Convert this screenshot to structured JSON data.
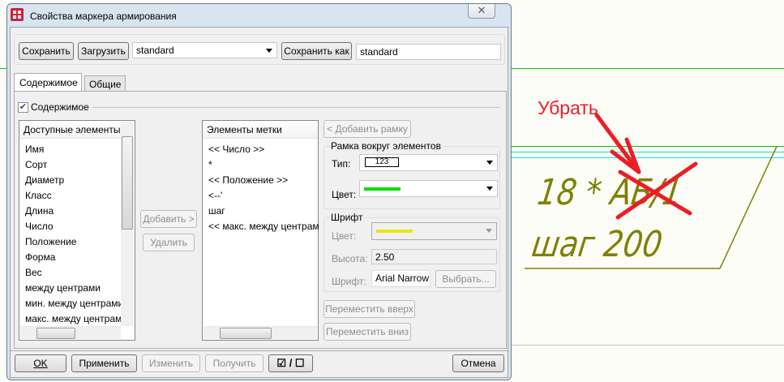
{
  "window": {
    "title": "Свойства маркера армирования",
    "close": "✕"
  },
  "toolbar": {
    "save": "Сохранить",
    "load": "Загрузить",
    "preset": "standard",
    "save_as": "Сохранить как",
    "save_as_name": "standard"
  },
  "tabs": [
    {
      "label": "Содержимое",
      "active": true
    },
    {
      "label": "Общие",
      "active": false
    }
  ],
  "content": {
    "checkbox_label": "Содержимое",
    "checked": true,
    "available": {
      "header": "Доступные элементы",
      "items": [
        "Имя",
        "Сорт",
        "Диаметр",
        "Класс",
        "Длина",
        "Число",
        "Положение",
        "Форма",
        "Вес",
        "между центрами",
        "мин. между центрами",
        "макс. между центрами"
      ]
    },
    "add": "Добавить >",
    "remove": "Удалить",
    "marker": {
      "header": "Элементы метки",
      "items": [
        "<< Число >>",
        "*",
        "<< Положение >>",
        "<--'",
        "шаг",
        "<< макс. между центрами >>"
      ]
    },
    "add_frame": "< Добавить рамку",
    "frame": {
      "title": "Рамка вокруг элементов",
      "type_label": "Тип:",
      "type_value": "123",
      "color_label": "Цвет:",
      "color": "#00e000"
    },
    "font": {
      "title": "Шрифт",
      "color_label": "Цвет:",
      "color": "#e8e800",
      "height_label": "Высота:",
      "height": "2.50",
      "font_label": "Шрифт:",
      "font_value": "Arial Narrow",
      "choose": "Выбрать..."
    },
    "move_up": "Переместить вверх",
    "move_down": "Переместить вниз"
  },
  "footer": {
    "ok": "OK",
    "apply": "Применить",
    "modify": "Изменить",
    "get": "Получить",
    "toggle": "☑ / ☐",
    "cancel": "Отмена"
  },
  "drawing": {
    "annotation": "Убрать",
    "line1": "18 * АБ/1",
    "line2": "шаг 200",
    "annotation_color": "#ee1c25"
  }
}
